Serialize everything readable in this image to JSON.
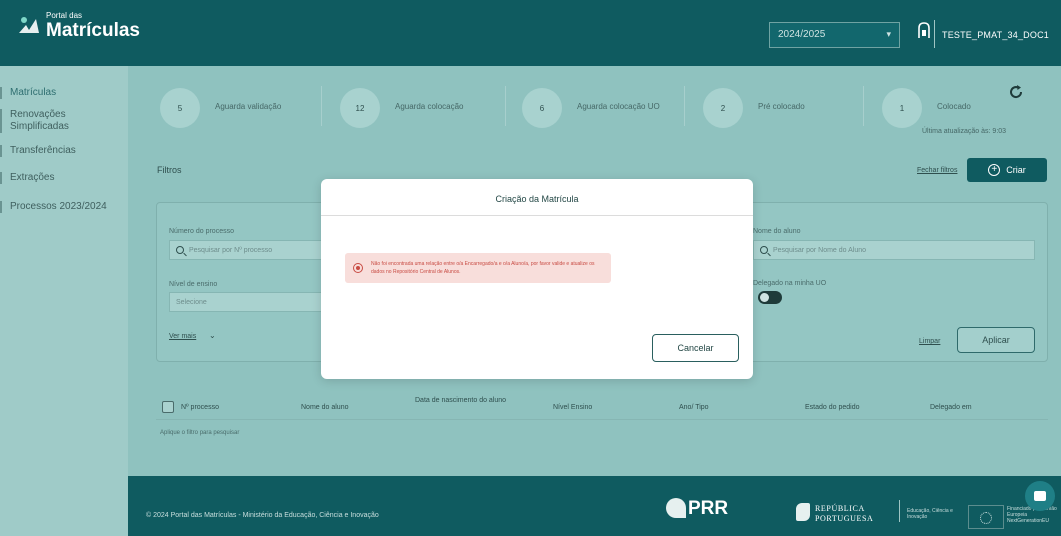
{
  "header": {
    "portal_small": "Portal das",
    "portal_big": "Matrículas",
    "year_value": "2024/2025",
    "user": "TESTE_PMAT_34_DOC1"
  },
  "sidebar": {
    "items": [
      {
        "label": "Matrículas"
      },
      {
        "label": "Renovações Simplificadas"
      },
      {
        "label": "Transferências"
      },
      {
        "label": "Extrações"
      },
      {
        "label": "Processos 2023/2024"
      }
    ]
  },
  "steps": [
    {
      "count": "5",
      "label": "Aguarda validação"
    },
    {
      "count": "12",
      "label": "Aguarda colocação"
    },
    {
      "count": "6",
      "label": "Aguarda colocação UO"
    },
    {
      "count": "2",
      "label": "Pré colocado"
    },
    {
      "count": "1",
      "label": "Colocado"
    }
  ],
  "last_update": "Última atualização às: 9:03",
  "filters": {
    "title": "Filtros",
    "close_link": "Fechar filtros",
    "create_label": "Criar",
    "process_number_label": "Número do processo",
    "process_number_placeholder": "Pesquisar por Nº processo",
    "student_name_label": "Nome do aluno",
    "student_name_placeholder": "Pesquisar por Nome do Aluno",
    "level_label": "Nível de ensino",
    "level_value": "Selecione",
    "delegated_label": "Delegado na minha UO",
    "see_more": "Ver mais",
    "clear": "Limpar",
    "apply": "Aplicar"
  },
  "table": {
    "columns": [
      "Nº processo",
      "Nome do aluno",
      "Data de nascimento do aluno",
      "Nível Ensino",
      "Ano/ Tipo",
      "Estado do pedido",
      "Delegado em"
    ],
    "empty_note": "Aplique o filtro para pesquisar"
  },
  "footer": {
    "copyright": "© 2024 Portal das Matrículas - Ministério da Educação, Ciência e Inovação",
    "prr": "PRR",
    "republica_1": "REPÚBLICA",
    "republica_2": "PORTUGUESA",
    "min_text": "Educação, Ciência e Inovação",
    "eu_text": "Financiado pela União Europeia NextGenerationEU"
  },
  "modal": {
    "title": "Criação da Matrícula",
    "alert": "Não foi encontrada uma relação entre o/a Encarregado/a e o/a Aluno/a, por favor valide e atualize os dados no Repositório Central de Alunos.",
    "cancel_label": "Cancelar"
  },
  "colors": {
    "header_bg": "#0f5b60",
    "accent": "#0f5b60",
    "alert_bg": "#f8dedb",
    "alert_text": "#c84b43"
  }
}
